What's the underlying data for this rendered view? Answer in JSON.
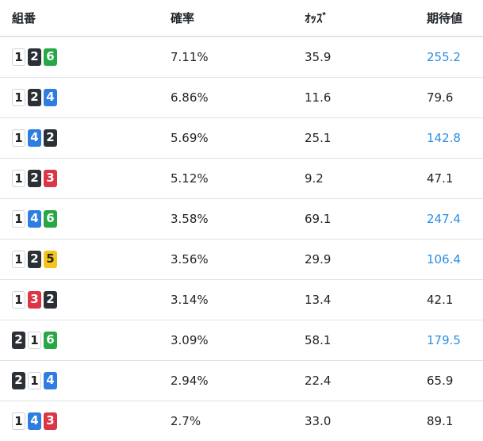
{
  "headers": {
    "combo": "組番",
    "prob": "確率",
    "odds": "ｵｯｽﾞ",
    "ev": "期待値"
  },
  "boat_colors": {
    "1": "#ffffff",
    "2": "#2b2f36",
    "3": "#dc3545",
    "4": "#2f7de1",
    "5": "#f5c518",
    "6": "#28a745"
  },
  "highlight_color": "#2d8fe0",
  "rows": [
    {
      "combo": [
        "1",
        "2",
        "6"
      ],
      "prob": "7.11%",
      "odds": "35.9",
      "ev": "255.2",
      "highlight": true
    },
    {
      "combo": [
        "1",
        "2",
        "4"
      ],
      "prob": "6.86%",
      "odds": "11.6",
      "ev": "79.6",
      "highlight": false
    },
    {
      "combo": [
        "1",
        "4",
        "2"
      ],
      "prob": "5.69%",
      "odds": "25.1",
      "ev": "142.8",
      "highlight": true
    },
    {
      "combo": [
        "1",
        "2",
        "3"
      ],
      "prob": "5.12%",
      "odds": "9.2",
      "ev": "47.1",
      "highlight": false
    },
    {
      "combo": [
        "1",
        "4",
        "6"
      ],
      "prob": "3.58%",
      "odds": "69.1",
      "ev": "247.4",
      "highlight": true
    },
    {
      "combo": [
        "1",
        "2",
        "5"
      ],
      "prob": "3.56%",
      "odds": "29.9",
      "ev": "106.4",
      "highlight": true
    },
    {
      "combo": [
        "1",
        "3",
        "2"
      ],
      "prob": "3.14%",
      "odds": "13.4",
      "ev": "42.1",
      "highlight": false
    },
    {
      "combo": [
        "2",
        "1",
        "6"
      ],
      "prob": "3.09%",
      "odds": "58.1",
      "ev": "179.5",
      "highlight": true
    },
    {
      "combo": [
        "2",
        "1",
        "4"
      ],
      "prob": "2.94%",
      "odds": "22.4",
      "ev": "65.9",
      "highlight": false
    },
    {
      "combo": [
        "1",
        "4",
        "3"
      ],
      "prob": "2.7%",
      "odds": "33.0",
      "ev": "89.1",
      "highlight": false
    }
  ]
}
